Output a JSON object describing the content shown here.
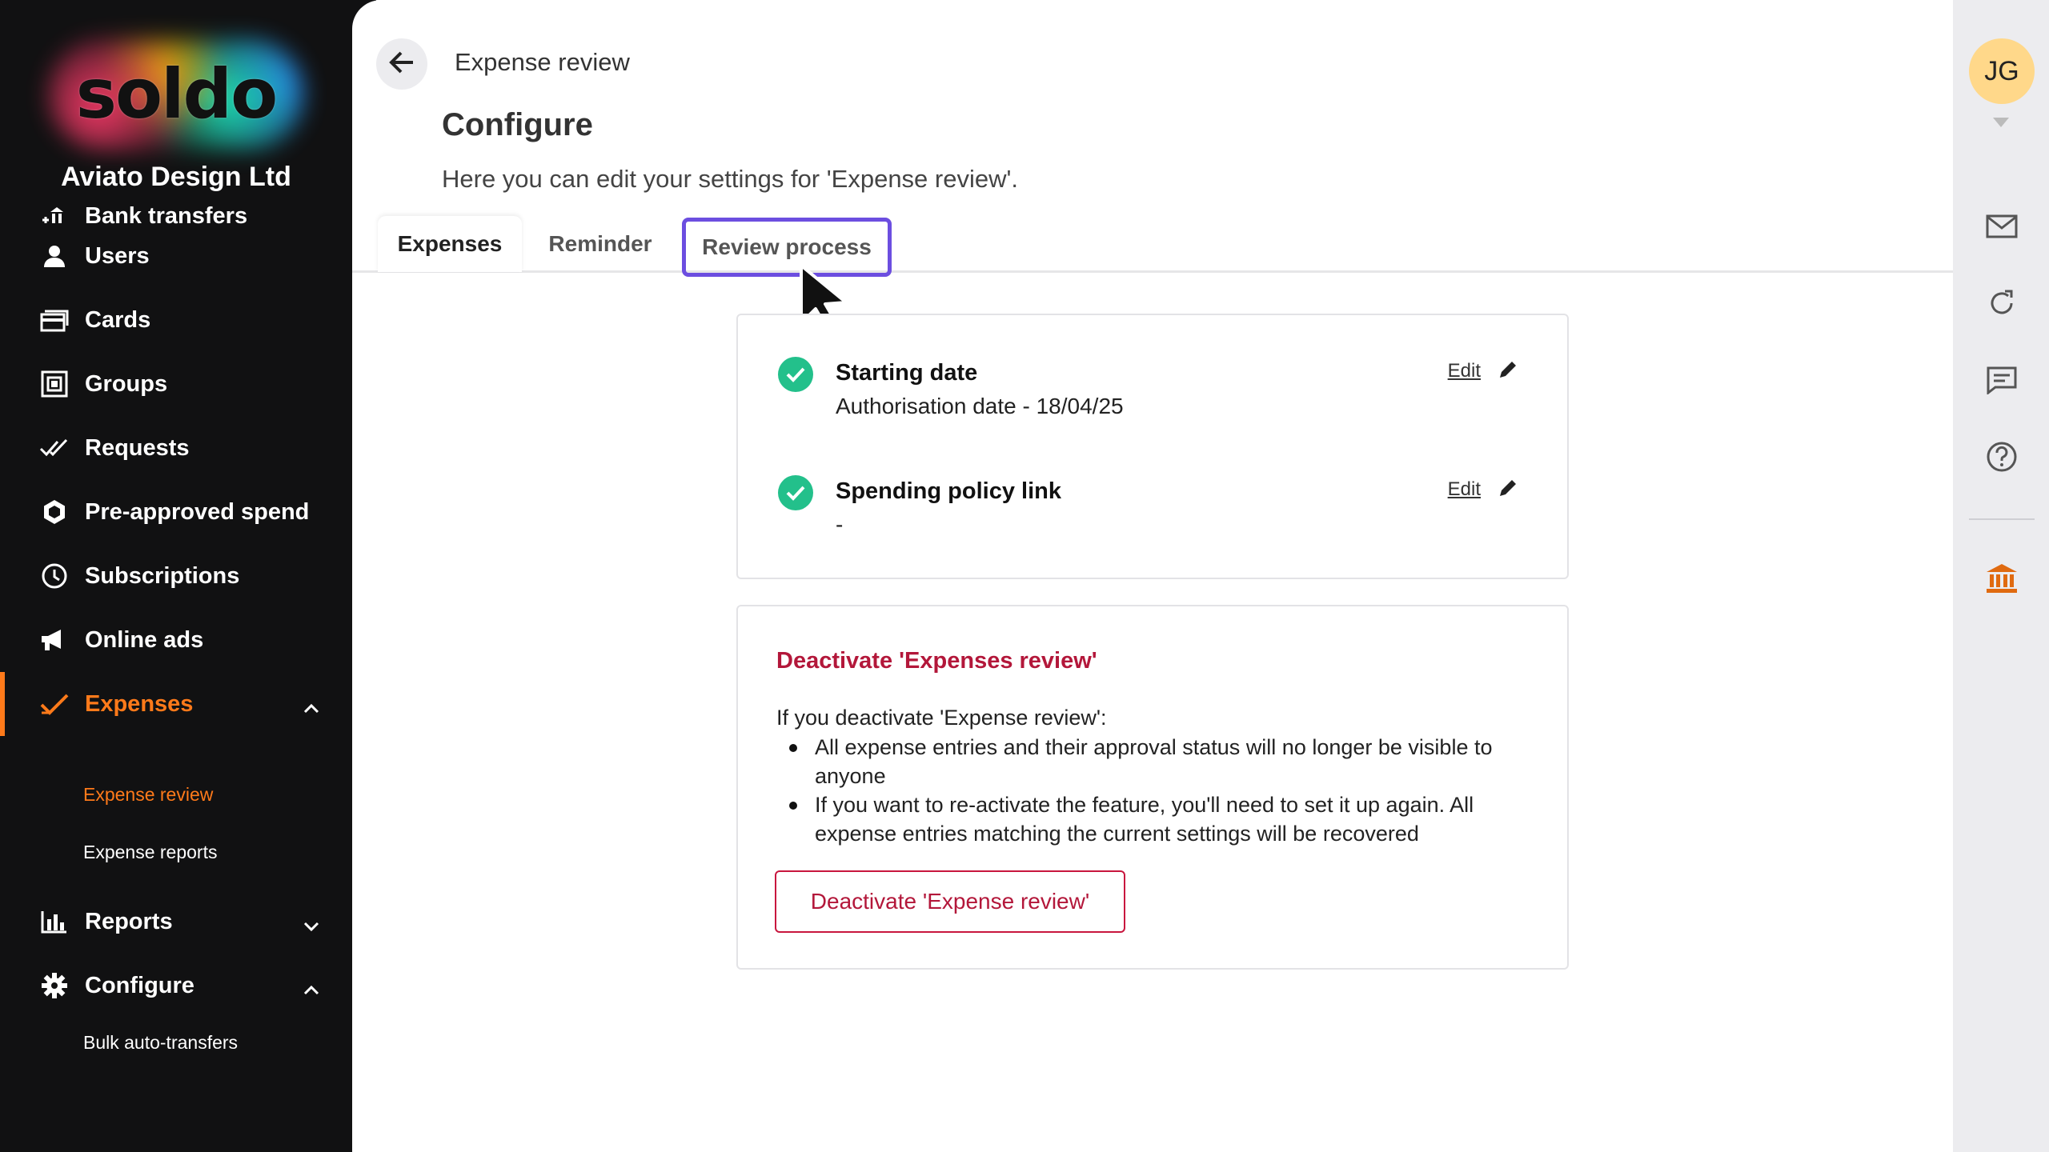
{
  "sidebar": {
    "logo_text": "soldo",
    "company": "Aviato Design Ltd",
    "items": [
      {
        "label": "Bank transfers",
        "icon": "bank-transfer-icon"
      },
      {
        "label": "Users",
        "icon": "user-icon"
      },
      {
        "label": "Cards",
        "icon": "cards-icon"
      },
      {
        "label": "Groups",
        "icon": "groups-icon"
      },
      {
        "label": "Requests",
        "icon": "double-check-icon"
      },
      {
        "label": "Pre-approved spend",
        "icon": "hexagon-icon"
      },
      {
        "label": "Subscriptions",
        "icon": "clock-icon"
      },
      {
        "label": "Online ads",
        "icon": "megaphone-icon"
      },
      {
        "label": "Expenses",
        "icon": "check-icon"
      },
      {
        "label": "Reports",
        "icon": "bar-chart-icon"
      },
      {
        "label": "Configure",
        "icon": "gear-icon"
      }
    ],
    "expenses_sub": [
      "Expense review",
      "Expense reports"
    ],
    "configure_sub": [
      "Bulk auto-transfers"
    ]
  },
  "header": {
    "breadcrumb": "Expense review",
    "title": "Configure",
    "subtitle": "Here you can edit your settings for 'Expense review'."
  },
  "tabs": [
    "Expenses",
    "Reminder",
    "Review process"
  ],
  "settings": {
    "rows": [
      {
        "title": "Starting date",
        "value": "Authorisation date - 18/04/25",
        "edit": "Edit"
      },
      {
        "title": "Spending policy link",
        "value": "-",
        "edit": "Edit"
      }
    ]
  },
  "deactivate": {
    "title": "Deactivate 'Expenses review'",
    "intro": "If you deactivate 'Expense review':",
    "bullets": [
      "All expense entries and their approval status will no longer be visible to anyone",
      "If you want to re-activate the feature, you'll need to set it up again. All expense entries matching the current settings will be recovered"
    ],
    "button": "Deactivate 'Expense review'"
  },
  "rail": {
    "avatar": "JG",
    "icons": [
      "mail-icon",
      "refresh-icon",
      "chat-icon",
      "help-icon",
      "bank-icon"
    ]
  },
  "colors": {
    "accent": "#ff7a1a",
    "danger": "#b3173a",
    "success": "#23c08b",
    "focus": "#6c4ee0"
  }
}
